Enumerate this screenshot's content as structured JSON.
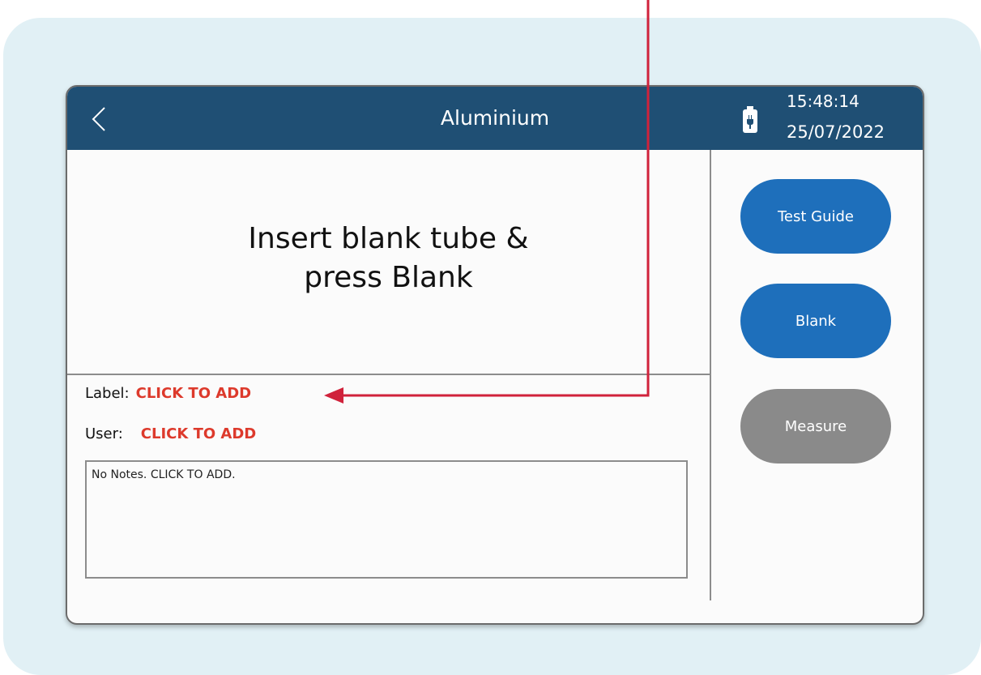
{
  "header": {
    "title": "Aluminium",
    "time": "15:48:14",
    "date": "25/07/2022"
  },
  "main": {
    "instruction_line1": "Insert blank tube &",
    "instruction_line2": "press Blank"
  },
  "fields": {
    "label_caption": "Label:",
    "label_value": "CLICK TO ADD",
    "user_caption": "User:",
    "user_value": "CLICK TO ADD",
    "notes_placeholder": "No Notes. CLICK TO ADD."
  },
  "buttons": {
    "test_guide": "Test Guide",
    "blank": "Blank",
    "measure": "Measure"
  },
  "colors": {
    "header_bg": "#1f4f74",
    "primary_button": "#1e6fbb",
    "disabled_button": "#8a8a8a",
    "click_to_add": "#dd3a2c",
    "annotation_arrow": "#d0223b",
    "backdrop": "#e1f0f5"
  },
  "icons": [
    "back-chevron-icon",
    "battery-charging-icon"
  ]
}
